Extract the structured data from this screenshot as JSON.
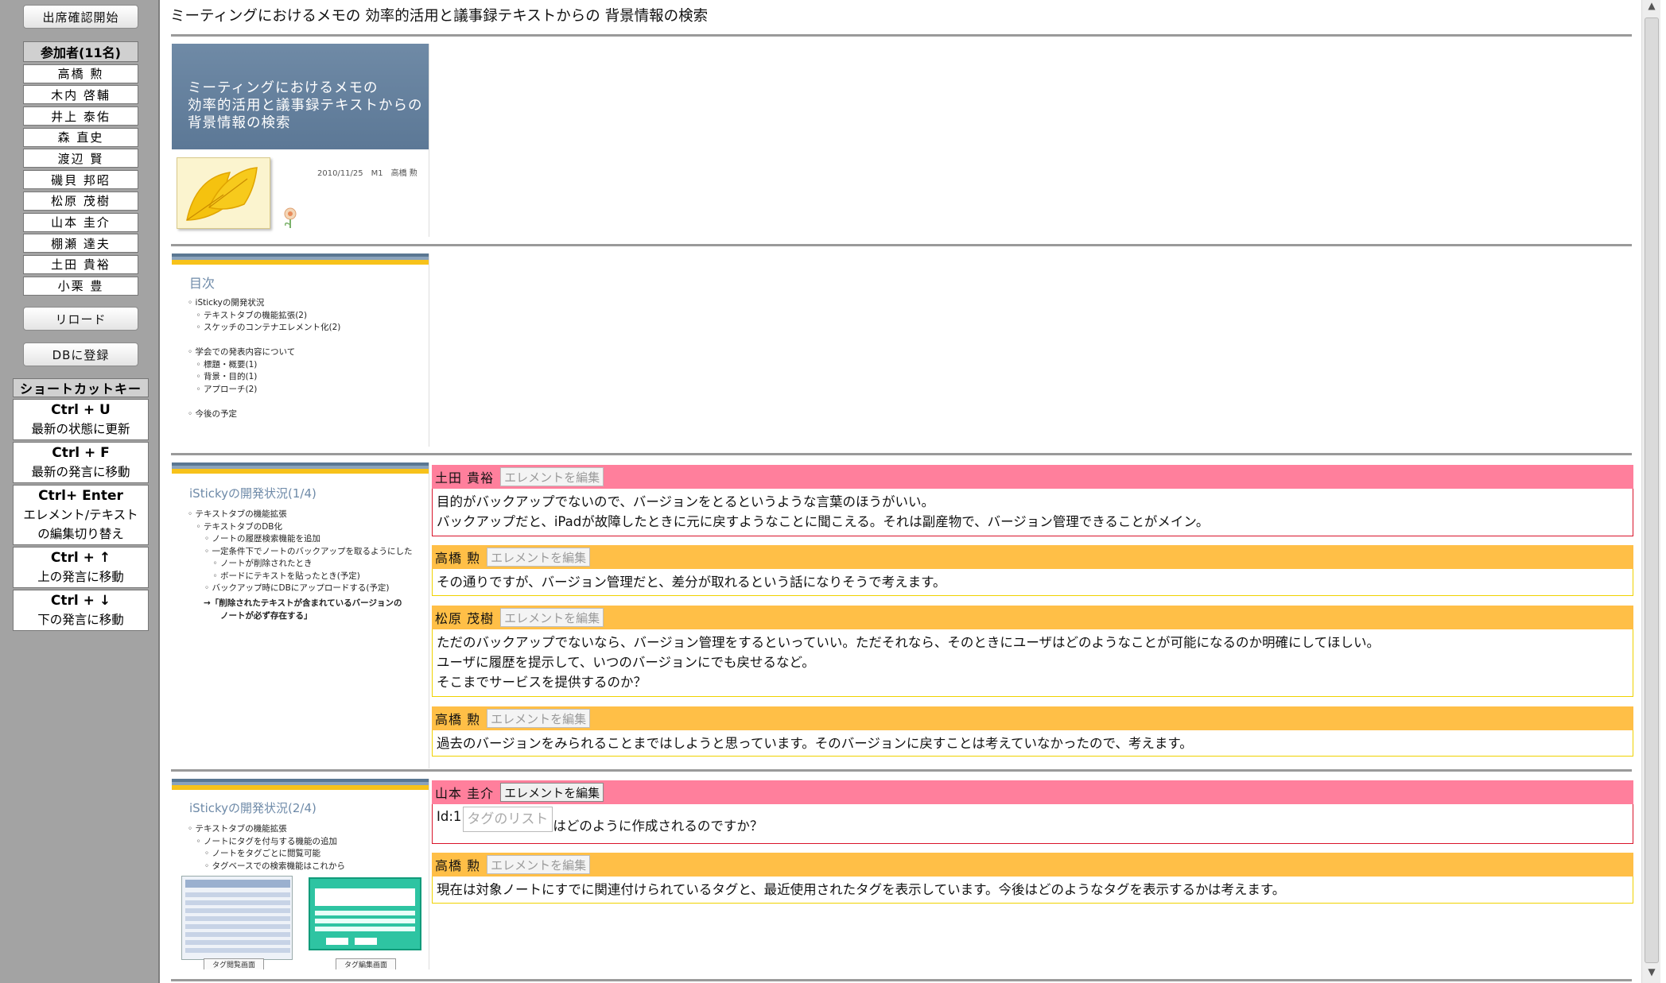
{
  "sidebar": {
    "attendance_button": "出席確認開始",
    "participants_header": "参加者(11名)",
    "participants": [
      "高橋 勲",
      "木内 啓輔",
      "井上 泰佑",
      "森 直史",
      "渡辺 賢",
      "磯貝 邦昭",
      "松原 茂樹",
      "山本 圭介",
      "棚瀬 達夫",
      "土田 貴裕",
      "小栗 豊"
    ],
    "reload_button": "リロード",
    "db_button": "DBに登録",
    "shortcut_header": "ショートカットキー",
    "shortcuts": [
      {
        "key": "Ctrl + U",
        "desc": "最新の状態に更新"
      },
      {
        "key": "Ctrl + F",
        "desc": "最新の発言に移動"
      },
      {
        "key": "Ctrl+ Enter",
        "desc": "エレメント/テキスト",
        "desc2": "の編集切り替え"
      },
      {
        "key": "Ctrl + ↑",
        "desc": "上の発言に移動"
      },
      {
        "key": "Ctrl + ↓",
        "desc": "下の発言に移動"
      }
    ]
  },
  "main": {
    "title": "ミーティングにおけるメモの 効率的活用と議事録テキストからの 背景情報の検索",
    "slides": [
      {
        "banner": "ミーティングにおけるメモの\n効率的活用と議事録テキストからの\n背景情報の検索",
        "date": "2010/11/25　M1　高橋 勲"
      },
      {
        "title": "目次",
        "body": "◦ iStickyの開発状況\n　◦ テキストタブの機能拡張(2)\n　◦ スケッチのコンテナエレメント化(2)\n\n◦ 学会での発表内容について\n　◦ 標題・概要(1)\n　◦ 背景・目的(1)\n　◦ アプローチ(2)\n\n◦ 今後の予定"
      },
      {
        "title": "iStickyの開発状況(1/4)",
        "body": "◦ テキストタブの機能拡張\n　◦ テキストタブのDB化",
        "body_orange": "　　◦ ノートの履歴検索機能を追加\n　　◦ 一定条件下でノートのバックアップを取るようにした\n　　　◦ ノートが削除されたとき\n　　　◦ ボードにテキストを貼ったとき(予定)\n　　◦ バックアップ時にDBにアップロードする(予定)",
        "body_red": "→「削除されたテキストが含まれているバージョンの\n　　ノートが必ず存在する」"
      },
      {
        "title": "iStickyの開発状況(2/4)",
        "body": "◦ テキストタブの機能拡張\n　◦ ノートにタグを付与する機能の追加",
        "body_orange": "　　◦ ノートをタグごとに閲覧可能\n　　◦ タグベースでの検索機能はこれから",
        "caption_left": "タグ閲覧画面",
        "caption_right": "タグ編集画面"
      }
    ],
    "edit_label": "エレメントを編集",
    "utterances": [
      {
        "speaker": "土田 貴裕",
        "lines": [
          "目的がバックアップでないので、バージョンをとるというような言葉のほうがいい。",
          "バックアップだと、iPadが故障したときに元に戻すようなことに聞こえる。それは副産物で、バージョン管理できることがメイン。"
        ]
      },
      {
        "speaker": "高橋 勲",
        "lines": [
          "その通りですが、バージョン管理だと、差分が取れるという話になりそうで考えます。"
        ]
      },
      {
        "speaker": "松原 茂樹",
        "lines": [
          "ただのバックアップでないなら、バージョン管理をするといっていい。ただそれなら、そのときにユーザはどのようなことが可能になるのか明確にしてほしい。",
          "ユーザに履歴を提示して、いつのバージョンにでも戻せるなど。",
          "そこまでサービスを提供するのか？"
        ]
      },
      {
        "speaker": "高橋 勲",
        "lines": [
          "過去のバージョンをみられることまではしようと思っています。そのバージョンに戻すことは考えていなかったので、考えます。"
        ]
      },
      {
        "speaker": "山本 圭介",
        "id_label": "Id:1",
        "tag_placeholder": "タグのリスト",
        "tail": "はどのように作成されるのですか？"
      },
      {
        "speaker": "高橋 勲",
        "lines": [
          "現在は対象ノートにすでに関連付けられているタグと、最近使用されたタグを表示しています。今後はどのようなタグを表示するかは考えます。"
        ]
      }
    ]
  },
  "colors": {
    "sidebar_bg": "#a3a3a3",
    "question_header": "#ff7f9c",
    "question_border": "#d9142a",
    "answer_header": "#ffbf47",
    "answer_border": "#f0d200",
    "slide_banner": "#6f8aa6"
  }
}
